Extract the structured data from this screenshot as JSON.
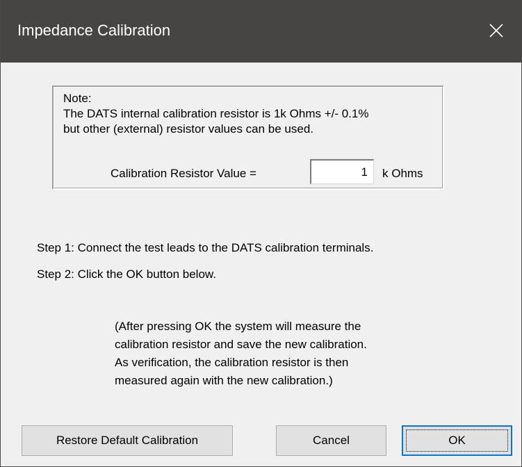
{
  "window": {
    "title": "Impedance Calibration"
  },
  "note": {
    "heading": "Note:",
    "line1": "The DATS internal calibration resistor is 1k Ohms +/- 0.1%",
    "line2": "but other (external) resistor values can be used.",
    "cal_label": "Calibration Resistor Value =",
    "cal_value": "1",
    "cal_unit": "k Ohms"
  },
  "steps": {
    "step1": "Step 1: Connect the test leads to the DATS calibration terminals.",
    "step2": "Step 2: Click the OK button below."
  },
  "info": {
    "line1": "(After pressing OK the system will measure the",
    "line2": "calibration resistor and save the new calibration.",
    "line3": "As verification, the calibration resistor is then",
    "line4": "measured again with the new calibration.)"
  },
  "buttons": {
    "restore": "Restore Default Calibration",
    "cancel": "Cancel",
    "ok": "OK"
  },
  "icons": {
    "close": "close-icon"
  },
  "colors": {
    "titlebar": "#474544",
    "dialog_bg": "#f0f0f0",
    "default_button_border": "#0078d7"
  }
}
